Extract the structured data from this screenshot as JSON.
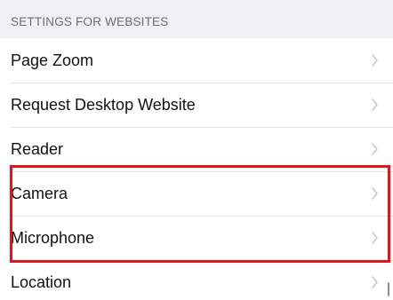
{
  "section": {
    "header": "SETTINGS FOR WEBSITES"
  },
  "rows": [
    {
      "label": "Page Zoom"
    },
    {
      "label": "Request Desktop Website"
    },
    {
      "label": "Reader"
    },
    {
      "label": "Camera"
    },
    {
      "label": "Microphone"
    },
    {
      "label": "Location"
    }
  ],
  "icons": {
    "chevron": "chevron-right-icon"
  },
  "colors": {
    "highlight": "#e3141c",
    "background": "#efeff4",
    "chevron": "#c7c7cc"
  }
}
